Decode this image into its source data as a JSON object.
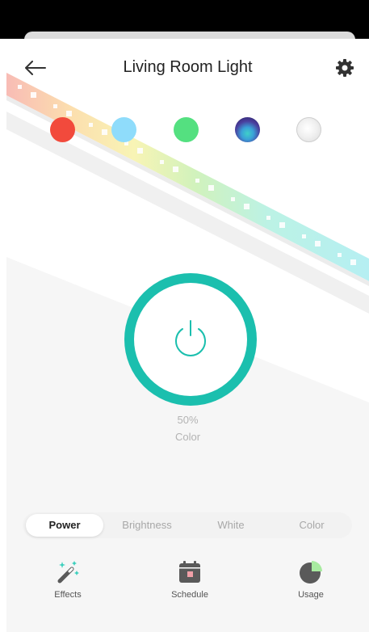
{
  "header": {
    "title": "Living Room Light",
    "back_icon": "arrow-left-icon",
    "settings_icon": "gear-icon"
  },
  "swatches": [
    {
      "name": "red",
      "color": "#f24a3c"
    },
    {
      "name": "light-blue",
      "color": "#8fdcfb"
    },
    {
      "name": "green",
      "color": "#54e080"
    },
    {
      "name": "aurora",
      "color": "#4a3f9e"
    },
    {
      "name": "white",
      "color": "#e6e6e6"
    }
  ],
  "power": {
    "icon": "power-icon",
    "level": "50%",
    "mode": "Color",
    "accent": "#1bbfae"
  },
  "tabs": [
    {
      "label": "Power",
      "active": true
    },
    {
      "label": "Brightness",
      "active": false
    },
    {
      "label": "White",
      "active": false
    },
    {
      "label": "Color",
      "active": false
    }
  ],
  "bottom_nav": [
    {
      "label": "Effects",
      "icon": "magic-wand-icon"
    },
    {
      "label": "Schedule",
      "icon": "calendar-icon"
    },
    {
      "label": "Usage",
      "icon": "pie-chart-icon"
    }
  ]
}
